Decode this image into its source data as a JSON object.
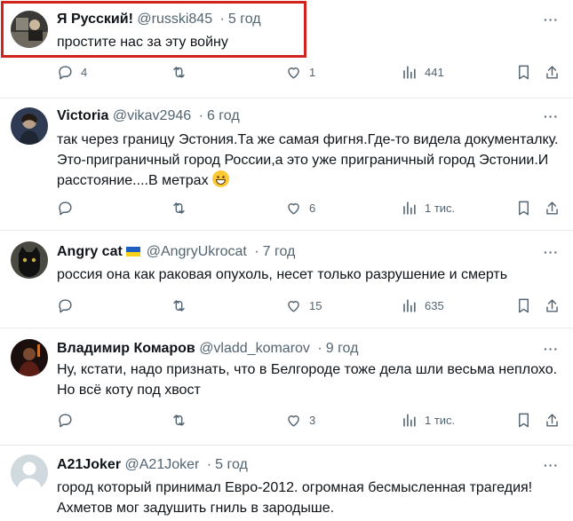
{
  "tweets": [
    {
      "name": "Я Русский!",
      "handle": "@russki845",
      "time": "5 год",
      "text": "простите нас за эту войну",
      "replies": "4",
      "retweets": "",
      "likes": "1",
      "views": "441"
    },
    {
      "name": "Victoria",
      "handle": "@vikav2946",
      "time": "6 год",
      "text": "так через границу Эстония.Та же самая фигня.Где-то видела документалку. Это-приграничный город России,а это уже приграничный город Эстонии.И расстояние....В метрах",
      "replies": "",
      "retweets": "",
      "likes": "6",
      "views": "1 тис."
    },
    {
      "name": "Angry cat",
      "handle": "@AngryUkrocat",
      "time": "7 год",
      "text": "россия она как раковая опухоль, несет только разрушение и смерть",
      "replies": "",
      "retweets": "",
      "likes": "15",
      "views": "635"
    },
    {
      "name": "Владимир Комаров",
      "handle": "@vladd_komarov",
      "time": "9 год",
      "text": "Ну, кстати, надо признать, что в Белгороде тоже дела шли весьма неплохо. Но всё коту под хвост",
      "replies": "",
      "retweets": "",
      "likes": "3",
      "views": "1 тис."
    },
    {
      "name": "A21Joker",
      "handle": "@A21Joker",
      "time": "5 год",
      "text": "город который принимал Евро-2012. огромная бесмысленная трагедия! Ахметов мог задушить гниль в зародыше."
    }
  ],
  "separator": "·",
  "more_glyph": "···",
  "colors": {
    "text": "#0f1419",
    "secondary": "#536471",
    "highlight_border": "#d0231e",
    "divider": "#e6ecf0"
  },
  "icons": [
    "reply-icon",
    "retweet-icon",
    "like-icon",
    "views-icon",
    "bookmark-icon",
    "share-icon",
    "more-icon",
    "ukraine-flag-icon",
    "grinning-emoji-icon"
  ]
}
